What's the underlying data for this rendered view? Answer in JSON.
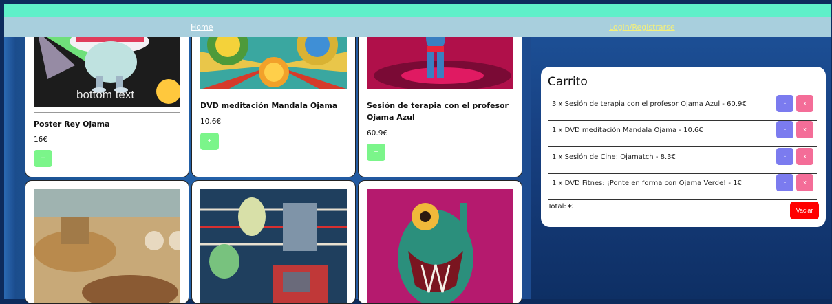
{
  "nav": {
    "home": "Home",
    "login": "Login/Registrarse"
  },
  "products": [
    {
      "name": "Poster Rey Ojama",
      "price": "16€",
      "add": "+",
      "image_caption": "bottom text"
    },
    {
      "name": "DVD meditación Mandala Ojama",
      "price": "10.6€",
      "add": "+"
    },
    {
      "name": "Sesión de terapia con el profesor Ojama Azul",
      "price": "60.9€",
      "add": "+"
    },
    {
      "name": "",
      "price": ""
    },
    {
      "name": "",
      "price": ""
    },
    {
      "name": "",
      "price": ""
    }
  ],
  "cart": {
    "title": "Carrito",
    "items": [
      {
        "text": "3 x Sesión de terapia con el profesor Ojama Azul - 60.9€",
        "minus": "-",
        "remove": "x"
      },
      {
        "text": "1 x DVD meditación Mandala Ojama - 10.6€",
        "minus": "-",
        "remove": "x"
      },
      {
        "text": "1 x Sesión de Cine: Ojamatch - 8.3€",
        "minus": "-",
        "remove": "x"
      },
      {
        "text": "1 x DVD Fitnes: ¡Ponte en forma con Ojama Verde! - 1€",
        "minus": "-",
        "remove": "x"
      }
    ],
    "total": "Total: €",
    "clear": "Vaciar"
  },
  "colors": {
    "topbar": "#5ff0c9",
    "nav": "#a8cfdd",
    "add": "#7bf58a",
    "minus": "#7b7bef",
    "remove": "#f46d98",
    "clear": "#ff0000"
  }
}
